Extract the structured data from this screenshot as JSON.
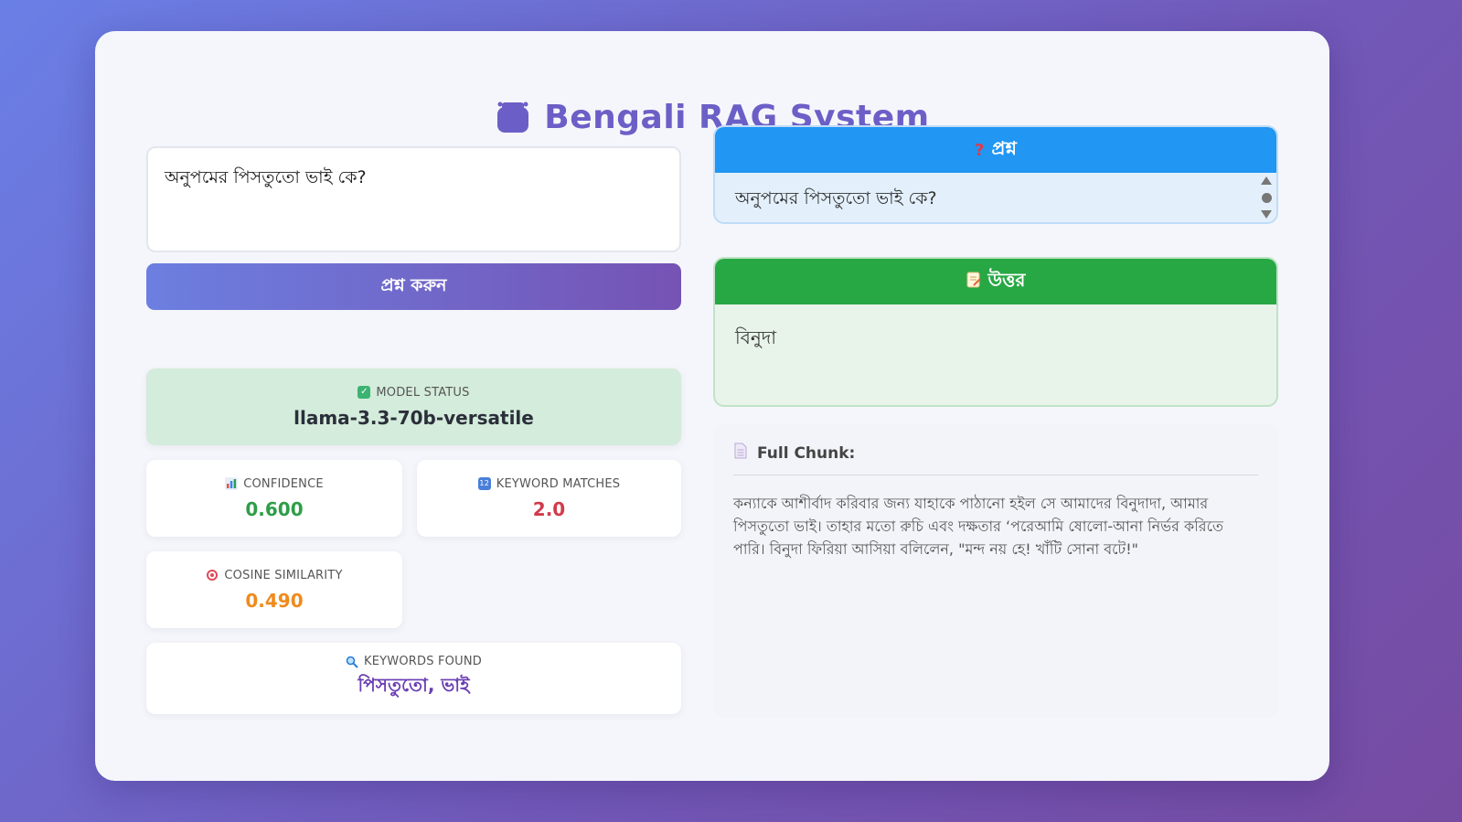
{
  "app": {
    "title": "Bengali RAG System",
    "title_icon": "robot-icon"
  },
  "query": {
    "input_value": "অনুপমের পিসতুতো ভাই কে?",
    "submit_label": "প্রশ্ন করুন"
  },
  "stats": {
    "model_status": {
      "label": "MODEL STATUS",
      "value": "llama-3.3-70b-versatile",
      "icon": "check-icon"
    },
    "confidence": {
      "label": "CONFIDENCE",
      "value": "0.600",
      "icon": "bar-chart-icon",
      "color": "#2e9e48"
    },
    "keyword_matches": {
      "label": "KEYWORD MATCHES",
      "value": "2.0",
      "icon": "numbers-icon",
      "color": "#d23a4a"
    },
    "cosine_similarity": {
      "label": "COSINE SIMILARITY",
      "value": "0.490",
      "icon": "target-icon",
      "color": "#f08a1c"
    },
    "keywords_found": {
      "label": "KEYWORDS FOUND",
      "value": "পিসতুতো, ভাই",
      "icon": "search-icon",
      "color": "#6a3fb3"
    }
  },
  "result": {
    "question_header": "প্রশ্ন",
    "question_text": "অনুপমের পিসতুতো ভাই কে?",
    "answer_header": "উত্তর",
    "answer_text": "বিনুদা",
    "chunk_header": "Full Chunk:",
    "chunk_text": "কন্যাকে আশীর্বাদ করিবার জন্য যাহাকে পাঠানো হইল সে আমাদের বিনুদাদা, আমার পিসতুতো ভাই। তাহার মতো রুচি এবং দক্ষতার ‘পরেআমি ষোলো-আনা নির্ভর করিতে পারি। বিনুদা ফিরিয়া আসিয়া বলিলেন, \"মন্দ নয় হে! খাঁটি সোনা বটে!\""
  },
  "colors": {
    "question_header_bg": "#2196f3",
    "answer_header_bg": "#27a844",
    "title_color": "#6b5fc7"
  }
}
